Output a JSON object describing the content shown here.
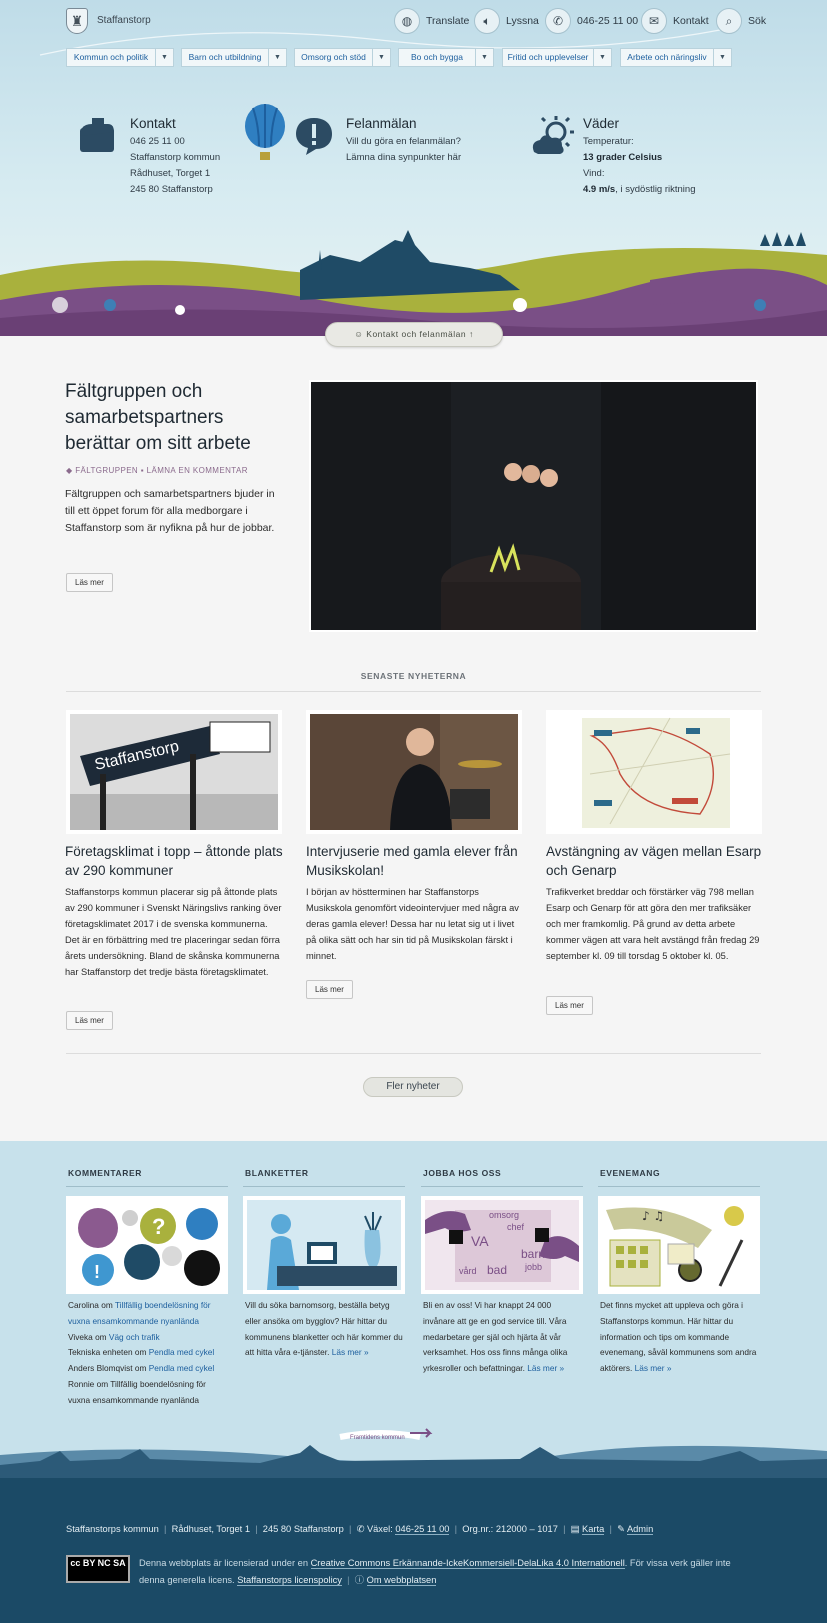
{
  "header": {
    "site_name": "Staffanstorp",
    "top_links": [
      {
        "label": "Translate",
        "icon": "globe-icon"
      },
      {
        "label": "Lyssna",
        "icon": "speaker-icon"
      },
      {
        "label": "046-25 11 00",
        "icon": "phone-icon"
      },
      {
        "label": "Kontakt",
        "icon": "mail-icon"
      },
      {
        "label": "Sök",
        "icon": "search-icon"
      }
    ],
    "nav": [
      "Kommun och politik",
      "Barn och utbildning",
      "Omsorg och stöd",
      "Bo och bygga",
      "Fritid och upplevelser",
      "Arbete och näringsliv"
    ]
  },
  "hero": {
    "kontakt": {
      "title": "Kontakt",
      "lines": [
        "046 25 11 00",
        "Staffanstorp kommun",
        "Rådhuset, Torget 1",
        "245 80 Staffanstorp"
      ]
    },
    "felanmalan": {
      "title": "Felanmälan",
      "lines": [
        "Vill du göra en felanmälan?",
        "Lämna dina synpunkter här"
      ]
    },
    "vader": {
      "title": "Väder",
      "temp_label": "Temperatur:",
      "temp_value": "13 grader Celsius",
      "wind_label": "Vind:",
      "wind_value": "4.9 m/s",
      "wind_dir": ", i sydöstlig riktning"
    },
    "contact_button": "Kontakt och felanmälan"
  },
  "feature": {
    "title": "Fältgruppen och samarbetspartners berättar om sitt arbete",
    "tag": "FÄLTGRUPPEN",
    "comment": "LÄMNA EN KOMMENTAR",
    "text": "Fältgruppen och samarbetspartners bjuder in till ett öppet forum för alla medborgare i Staffanstorp som är nyfikna på hur de jobbar.",
    "read_more": "Läs mer"
  },
  "news": {
    "section_title": "SENASTE NYHETERNA",
    "items": [
      {
        "title": "Företagsklimat i topp – åttonde plats av 290 kommuner",
        "text": "Staffanstorps kommun placerar sig på åttonde plats av 290 kommuner i Svenskt Näringslivs ranking över företagsklimatet 2017 i de svenska kommunerna. Det är en förbättring med tre placeringar sedan förra årets undersökning. Bland de skånska kommunerna har Staffanstorp det tredje bästa företagsklimatet.",
        "read_more": "Läs mer",
        "sign_text": "Staffanstorp"
      },
      {
        "title": "Intervjuserie med gamla elever från Musikskolan!",
        "text": "I början av höstterminen har Staffanstorps Musikskola genomfört videointervjuer med några av deras gamla elever! Dessa har nu letat sig ut i livet på olika sätt och har sin tid på Musikskolan färskt i minnet.",
        "read_more": "Läs mer"
      },
      {
        "title": "Avstängning av vägen mellan Esarp och Genarp",
        "text": "Trafikverket breddar och förstärker väg 798 mellan Esarp och Genarp för att göra den mer trafiksäker och mer framkomlig. På grund av detta arbete kommer vägen att vara helt avstängd från fredag 29 september kl. 09 till torsdag 5 oktober kl. 05.",
        "read_more": "Läs mer"
      }
    ],
    "more_button": "Fler nyheter"
  },
  "columns": {
    "kommentarer": {
      "title": "KOMMENTARER",
      "comments": [
        {
          "author": "Carolina",
          "sep": " om ",
          "link": "Tillfällig boendelösning för vuxna ensamkommande nyanlända",
          "is_link": true
        },
        {
          "author": "Viveka",
          "sep": " om ",
          "link": "Väg och trafik",
          "is_link": true
        },
        {
          "author": "Tekniska enheten",
          "sep": " om ",
          "link": "Pendla med cykel",
          "is_link": true
        },
        {
          "author": "Anders Blomqvist",
          "sep": " om ",
          "link": "Pendla med cykel",
          "is_link": true
        },
        {
          "author": "Ronnie",
          "sep": " om ",
          "link": "Tillfällig boendelösning för vuxna ensamkommande nyanlända",
          "is_link": false
        }
      ]
    },
    "blanketter": {
      "title": "BLANKETTER",
      "text": "Vill du söka barnomsorg, beställa betyg eller ansöka om bygglov? Här hittar du kommunens blanketter och här kommer du att hitta våra e-tjänster.",
      "link": "Läs mer »"
    },
    "jobba": {
      "title": "JOBBA HOS OSS",
      "text": "Bli en av oss! Vi har knappt 24 000 invånare att ge en god service till. Våra medarbetare ger själ och hjärta åt vår verksamhet. Hos oss finns många olika yrkesroller och befattningar.",
      "link": "Läs mer »",
      "img_words": [
        "omsorg",
        "chef",
        "VA",
        "barn",
        "jobb",
        "bad",
        "vård"
      ]
    },
    "evenemang": {
      "title": "EVENEMANG",
      "text": "Det finns mycket att uppleva och göra i Staffanstorps kommun. Här hittar du information och tips om kommande evenemang, såväl kommunens som andra aktörers.",
      "link": "Läs mer »"
    }
  },
  "footer": {
    "banner": "Framtidens kommun",
    "org": "Staffanstorps kommun",
    "address": "Rådhuset, Torget 1",
    "postal": "245 80 Staffanstorp",
    "vaxel_label": "Växel:",
    "vaxel_value": "046-25 11 00",
    "orgnr": "Org.nr.: 212000 – 1017",
    "karta": "Karta",
    "admin": "Admin",
    "cc_badge": "cc BY NC SA",
    "license_pre": "Denna webbplats är licensierad under en ",
    "license_link": "Creative Commons Erkännande-IckeKommersiell-DelaLika 4.0 Internationell",
    "license_post": ". För vissa verk gäller inte denna generella licens.",
    "policy": "Staffanstorps licenspolicy",
    "about": "Om webbplatsen"
  },
  "colors": {
    "accent": "#1d5f9e",
    "purple": "#7a4f86",
    "footer_bg": "#1b4a66",
    "blue_section": "#c7e1eb",
    "olive": "#a9b13d"
  }
}
